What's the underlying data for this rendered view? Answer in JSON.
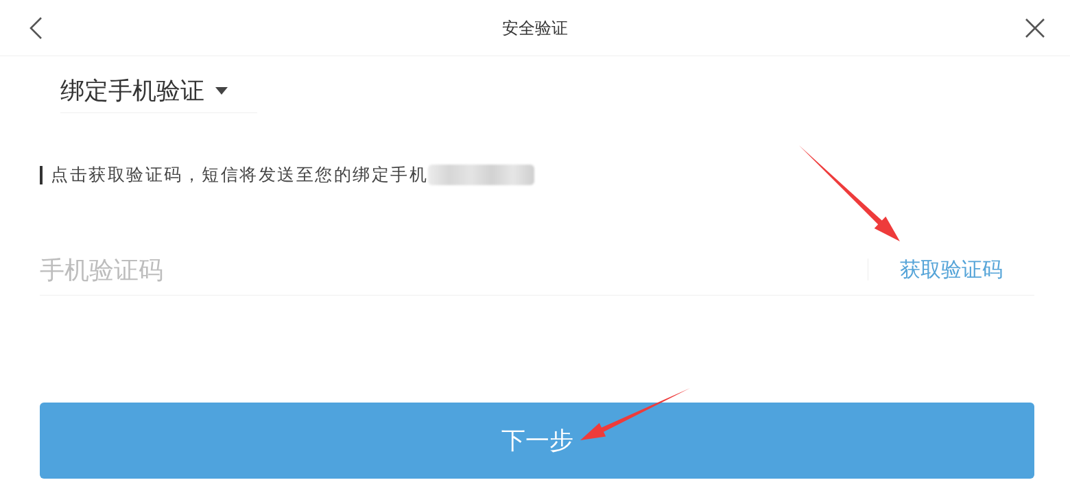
{
  "header": {
    "title": "安全验证"
  },
  "verify_method": {
    "label": "绑定手机验证"
  },
  "hint": {
    "text": "点击获取验证码，短信将发送至您的绑定手机",
    "phone_blurred": true
  },
  "code_field": {
    "placeholder": "手机验证码",
    "action_label": "获取验证码"
  },
  "next_button": {
    "label": "下一步"
  },
  "annotations": [
    {
      "kind": "arrow"
    },
    {
      "kind": "arrow"
    }
  ]
}
